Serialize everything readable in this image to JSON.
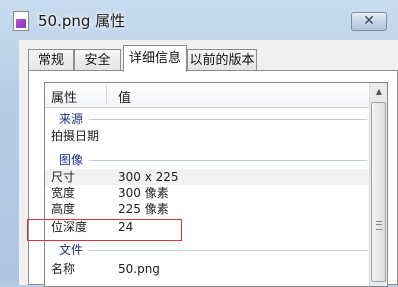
{
  "window": {
    "title": "50.png 属性",
    "close_glyph": "✕"
  },
  "tabs": [
    {
      "label": "常规",
      "active": false
    },
    {
      "label": "安全",
      "active": false
    },
    {
      "label": "详细信息",
      "active": true
    },
    {
      "label": "以前的版本",
      "active": false
    }
  ],
  "listview": {
    "headers": {
      "property": "属性",
      "value": "值"
    },
    "groups": {
      "source": "来源",
      "image": "图像",
      "file": "文件"
    },
    "rows": {
      "date_taken": {
        "key": "拍摄日期",
        "value": ""
      },
      "dimensions": {
        "key": "尺寸",
        "value": "300 x 225"
      },
      "width": {
        "key": "宽度",
        "value": "300 像素"
      },
      "height": {
        "key": "高度",
        "value": "225 像素"
      },
      "bit_depth": {
        "key": "位深度",
        "value": "24"
      },
      "name": {
        "key": "名称",
        "value": "50.png"
      }
    }
  },
  "annotation": {
    "color": "#d9353a",
    "target": "bit_depth"
  }
}
